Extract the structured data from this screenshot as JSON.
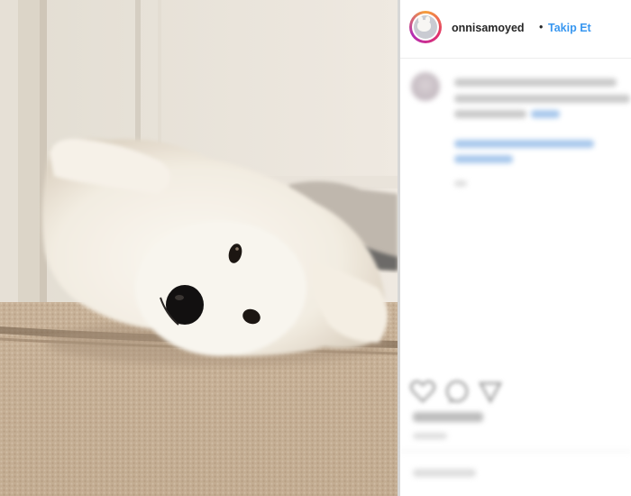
{
  "post": {
    "username": "onnisamoyed",
    "separator": "•",
    "follow_label": "Takip Et"
  },
  "colors": {
    "username": "#262626",
    "follow": "#3897f0",
    "avatar_ring": "#e1306c"
  },
  "icons": [
    "heart-icon",
    "comment-icon",
    "share-icon"
  ]
}
